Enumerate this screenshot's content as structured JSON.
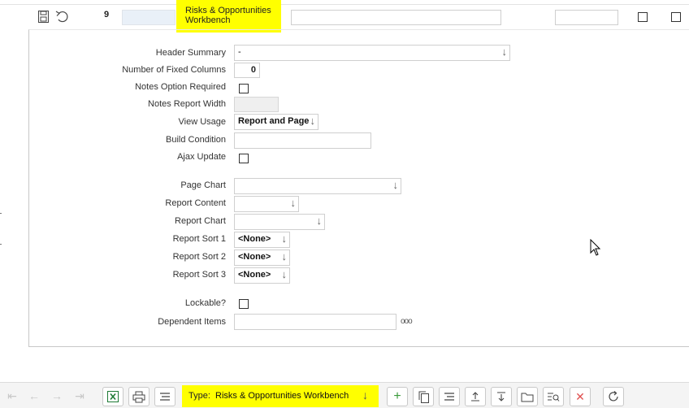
{
  "row": {
    "number": "9",
    "title_lines": [
      "Risks & Opportunities",
      "Workbench"
    ],
    "icons": [
      "save-icon",
      "undo-icon"
    ]
  },
  "form": {
    "header_summary": {
      "label": "Header Summary",
      "value": "-"
    },
    "fixed_columns": {
      "label": "Number of Fixed Columns",
      "value": "0"
    },
    "notes_option_required": {
      "label": "Notes Option Required"
    },
    "notes_report_width": {
      "label": "Notes Report Width"
    },
    "view_usage": {
      "label": "View Usage",
      "value": "Report and Page"
    },
    "build_condition": {
      "label": "Build Condition",
      "value": ""
    },
    "ajax_update": {
      "label": "Ajax Update"
    },
    "page_chart": {
      "label": "Page Chart",
      "value": ""
    },
    "report_content": {
      "label": "Report Content",
      "value": ""
    },
    "report_chart": {
      "label": "Report Chart",
      "value": ""
    },
    "report_sort_1": {
      "label": "Report Sort 1",
      "value": "<None>"
    },
    "report_sort_2": {
      "label": "Report Sort 2",
      "value": "<None>"
    },
    "report_sort_3": {
      "label": "Report Sort 3",
      "value": "<None>"
    },
    "lockable": {
      "label": "Lockable?"
    },
    "dependent_items": {
      "label": "Dependent Items",
      "value": "",
      "more": "ooo"
    }
  },
  "toolbar": {
    "type_label": "Type:",
    "type_value": "Risks & Opportunities Workbench",
    "highlight_color": "#ffff00"
  }
}
